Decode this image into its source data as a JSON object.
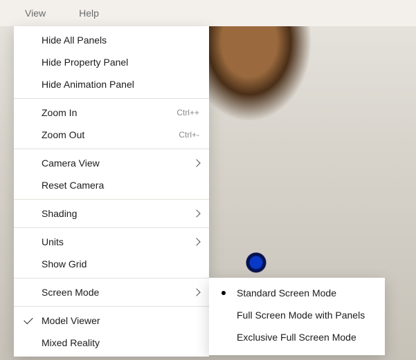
{
  "menubar": {
    "view": "View",
    "help": "Help"
  },
  "menu": {
    "groups": [
      {
        "items": [
          {
            "label": "Hide All Panels"
          },
          {
            "label": "Hide Property Panel"
          },
          {
            "label": "Hide Animation Panel"
          }
        ]
      },
      {
        "items": [
          {
            "label": "Zoom In",
            "shortcut": "Ctrl++"
          },
          {
            "label": "Zoom Out",
            "shortcut": "Ctrl+-"
          }
        ]
      },
      {
        "items": [
          {
            "label": "Camera View",
            "submenu": true
          },
          {
            "label": "Reset Camera"
          }
        ]
      },
      {
        "items": [
          {
            "label": "Shading",
            "submenu": true
          }
        ]
      },
      {
        "items": [
          {
            "label": "Units",
            "submenu": true
          },
          {
            "label": "Show Grid"
          }
        ]
      },
      {
        "items": [
          {
            "label": "Screen Mode",
            "submenu": true
          }
        ]
      },
      {
        "items": [
          {
            "label": "Model Viewer",
            "checked": true
          },
          {
            "label": "Mixed Reality"
          }
        ]
      }
    ]
  },
  "submenu": {
    "items": [
      {
        "label": "Standard Screen Mode",
        "selected": true
      },
      {
        "label": "Full Screen Mode with Panels"
      },
      {
        "label": "Exclusive Full Screen Mode"
      }
    ]
  }
}
